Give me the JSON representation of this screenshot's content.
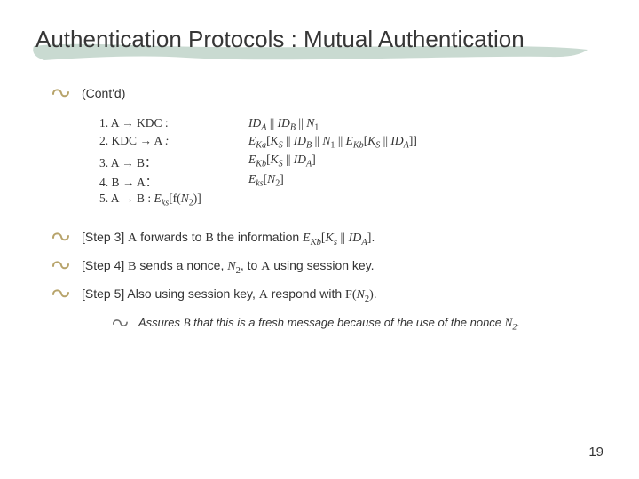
{
  "title": "Authentication Protocols : Mutual Authentication",
  "bullet0": "(Cont'd)",
  "protocol": {
    "l1": "1. A → KDC :",
    "r1": "ID A || ID B || N 1",
    "l2": "2. KDC → A :",
    "r2": "E Ka[K S || ID B || N 1 || E Kb[K S || ID A]]",
    "l3": "3. A → B：",
    "r3": "E Kb[K S || ID A]",
    "l4": "4. B → A：",
    "r4": "E ks[N 2]",
    "l5": "5. A → B : E ks[f(N 2)]"
  },
  "step3": "[Step 3] A forwards to B the information E Kb[K s || ID A].",
  "step4": "[Step 4] B sends a nonce, N 2, to A using session key.",
  "step5": "[Step 5] Also using session key, A respond with F(N 2).",
  "subnote": "Assures B that this is a fresh message because of the use of the nonce N 2.",
  "page": "19"
}
